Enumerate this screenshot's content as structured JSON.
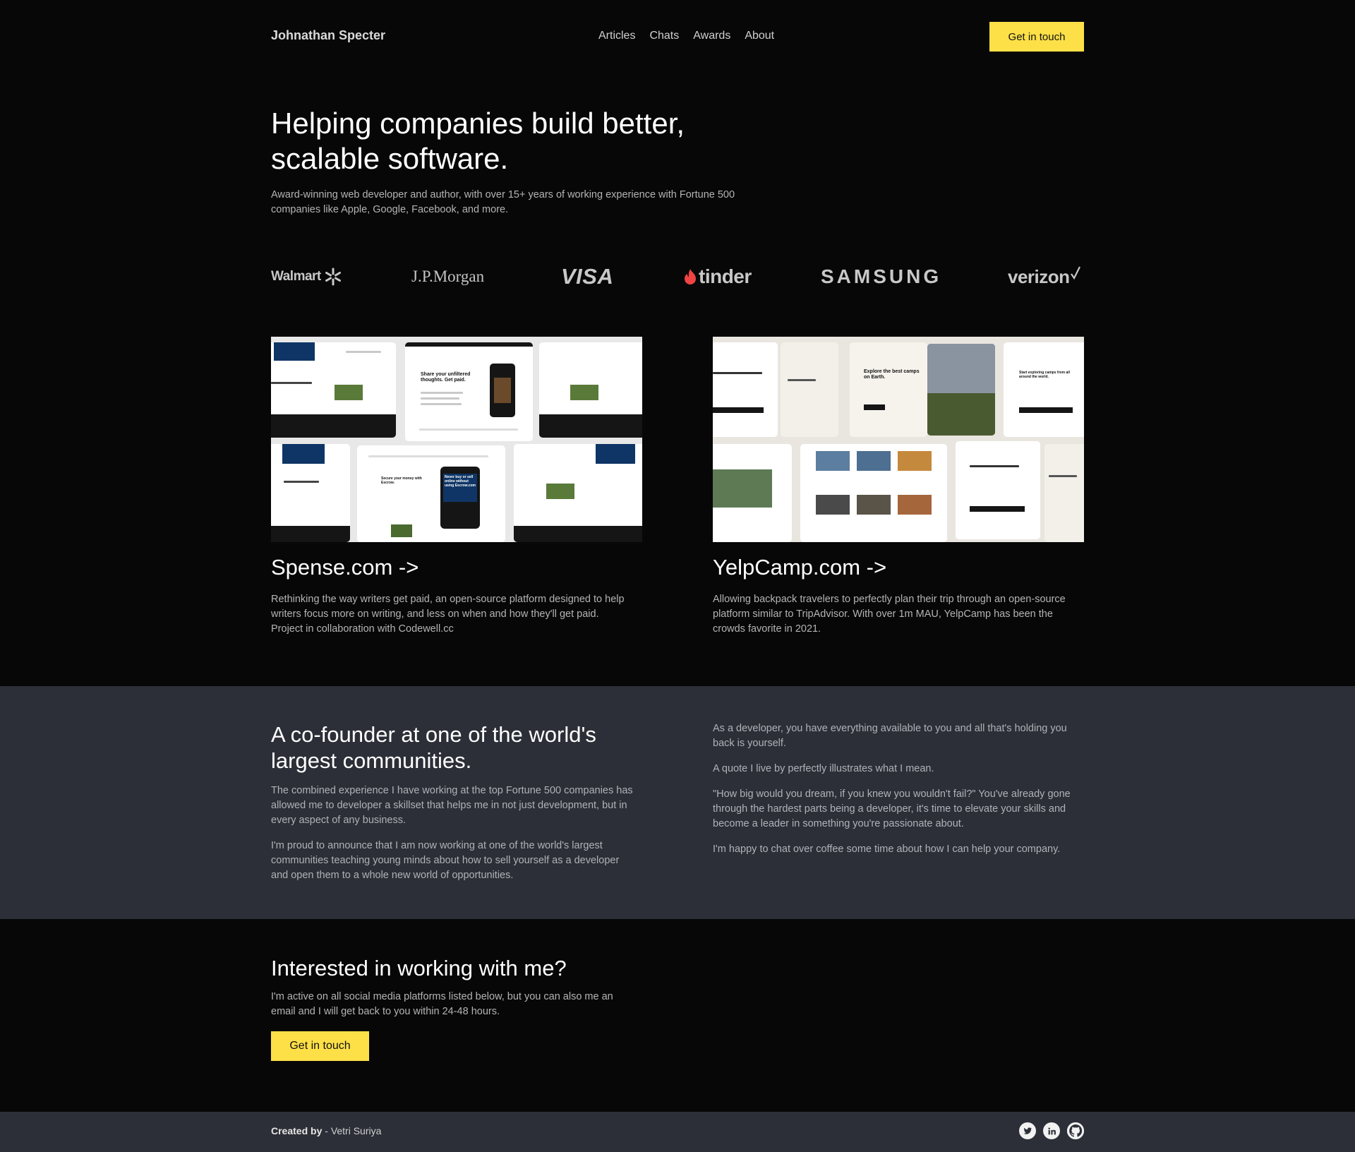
{
  "header": {
    "brand": "Johnathan Specter",
    "nav": [
      "Articles",
      "Chats",
      "Awards",
      "About"
    ],
    "cta_label": "Get in touch"
  },
  "hero": {
    "title_line1": "Helping companies build better,",
    "title_line2": "scalable software.",
    "subtitle_line1": "Award-winning web developer and author, with over 15+ years of working experience with Fortune 500",
    "subtitle_line2": "companies like Apple, Google, Facebook, and more."
  },
  "logos": {
    "walmart": "Walmart",
    "jpmorgan": "J.P.Morgan",
    "visa": "VISA",
    "tinder": "tinder",
    "samsung": "SAMSUNG",
    "verizon": "verizon"
  },
  "projects": [
    {
      "title": "Spense.com ->",
      "desc_line1": "Rethinking the way writers get paid, an open-source platform designed to help",
      "desc_line2": "writers focus more on writing, and less on when and how they'll get paid.",
      "desc_line3": "Project in collaboration with Codewell.cc",
      "mock_heading": "Share your unfiltered thoughts. Get paid.",
      "mock_heading2": "Never buy or sell online without using Escrow.com",
      "mock_heading3": "Secure your money with Escrow."
    },
    {
      "title": "YelpCamp.com ->",
      "desc_line1": "Allowing backpack travelers to perfectly plan their trip through an open-source",
      "desc_line2": "platform similar to TripAdvisor. With over 1m MAU, YelpCamp has been the",
      "desc_line3": "crowds favorite in 2021.",
      "mock_heading": "Explore the best camps on Earth.",
      "mock_heading2": "Start exploring camps from all around the world."
    }
  ],
  "about": {
    "title_line1": "A co-founder at one of the world's",
    "title_line2": "largest communities.",
    "left_p1_line1": "The combined experience I have working at the top Fortune 500 companies has",
    "left_p1_line2": "allowed me to developer a skillset that helps me in not just development, but in",
    "left_p1_line3": "every aspect of any business.",
    "left_p2_line1": "I'm proud to announce that I am now working at one of the world's largest",
    "left_p2_line2": "communities teaching young minds about how to sell yourself as a developer",
    "left_p2_line3": "and open them to a whole new world of opportunities.",
    "right_p1_line1": "As a developer, you have everything available to you and all that's holding you",
    "right_p1_line2": "back is yourself.",
    "right_p2": "A quote I live by perfectly illustrates what I mean.",
    "right_p3_line1": "\"How big would you dream, if you knew you wouldn't fail?\" You've already gone",
    "right_p3_line2": "through the hardest parts being a developer, it's time to elevate your skills and",
    "right_p3_line3": "become a leader in something you're passionate about.",
    "right_p4": "I'm happy to chat over coffee some time about how I can help your company."
  },
  "cta": {
    "title": "Interested in working with me?",
    "text_line1": "I'm active on all social media platforms listed below, but you can also me an",
    "text_line2": "email and I will get back to you within 24-48 hours.",
    "button": "Get in touch"
  },
  "footer": {
    "created_by": "Created by",
    "separator": " - ",
    "author": "Vetri Suriya",
    "social": [
      "twitter-icon",
      "linkedin-icon",
      "github-icon"
    ]
  },
  "colors": {
    "background": "#070708",
    "band": "#2c2f37",
    "accent": "#fde047",
    "text_muted": "#b4b4b4"
  }
}
